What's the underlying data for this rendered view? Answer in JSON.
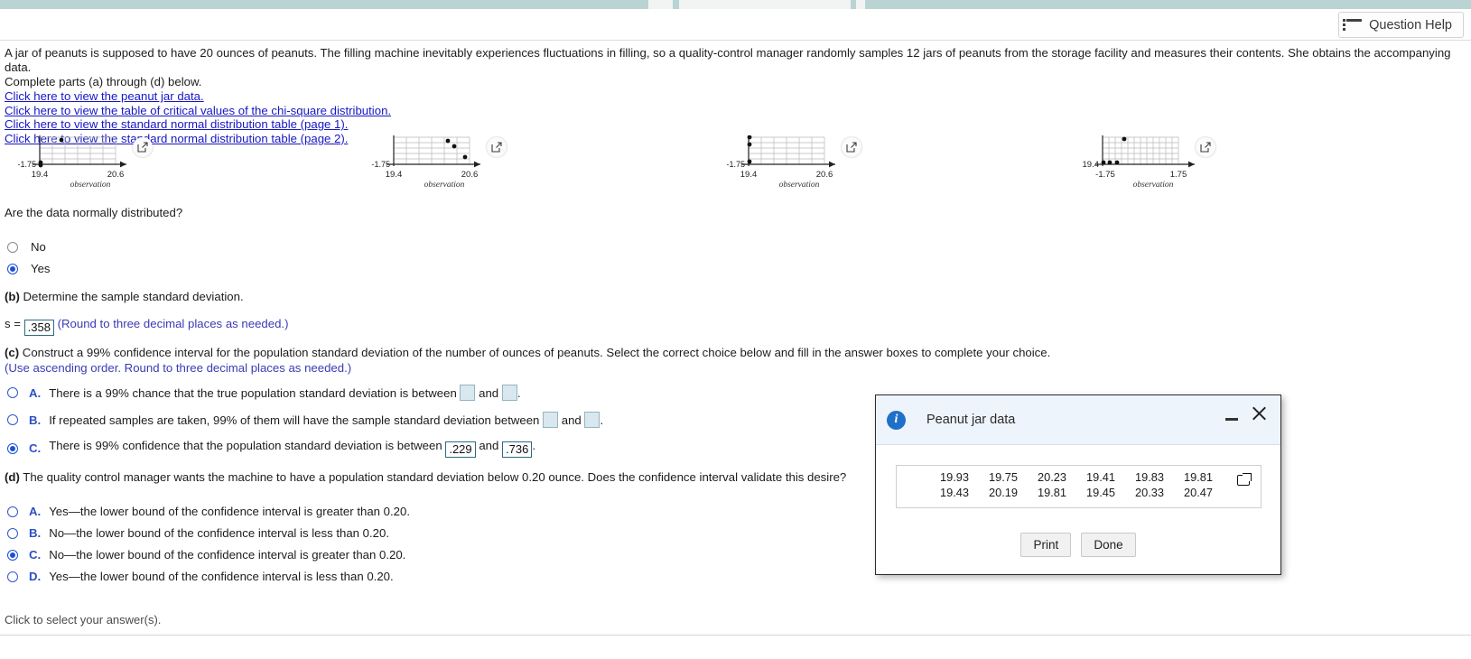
{
  "header": {
    "help_button_label": "Question Help",
    "help_icon": "list-icon"
  },
  "problem": {
    "paragraph": "A jar of peanuts is supposed to have 20 ounces of peanuts. The filling machine inevitably experiences fluctuations in filling, so a quality-control manager randomly samples 12 jars of peanuts from the storage facility and measures their contents. She obtains the accompanying data.",
    "instruction": "Complete parts (a) through (d) below.",
    "links": [
      "Click here to view the peanut jar data.",
      "Click here to view the table of critical values of the chi-square distribution.",
      "Click here to view the standard normal distribution table (page 1).",
      "Click here to view the standard normal distribution table (page 2)."
    ]
  },
  "plots": {
    "axis_caption": "observation",
    "expand_icon": "expand-icon",
    "items": [
      {
        "ylabel": "-1.75",
        "xmin_label": "19.4",
        "xmax_label": "20.6"
      },
      {
        "ylabel": "-1.75",
        "xmin_label": "19.4",
        "xmax_label": "20.6"
      },
      {
        "ylabel": "-1.75",
        "xmin_label": "19.4",
        "xmax_label": "20.6"
      },
      {
        "ylabel": "19.4",
        "xmin_label": "-1.75",
        "xmax_label": "1.75"
      }
    ]
  },
  "part_a": {
    "question": "Are the data normally distributed?",
    "options": [
      {
        "label": "No",
        "selected": false
      },
      {
        "label": "Yes",
        "selected": true
      }
    ]
  },
  "part_b": {
    "prefix": "(b)",
    "text": "Determine the sample standard deviation.",
    "s_label": "s =",
    "s_value": ".358",
    "rounding_hint": "(Round to three decimal places as needed.)"
  },
  "part_c": {
    "prefix": "(c)",
    "text": "Construct a 99% confidence interval for the population standard deviation of the number of ounces of peanuts. Select the correct choice below and fill in the answer boxes to complete your choice.",
    "hint": "(Use ascending order. Round to three decimal places as needed.)",
    "and_word": "and",
    "period": ".",
    "options": [
      {
        "letter": "A.",
        "text_before": "There is a 99% chance that the true population standard deviation is between",
        "value1": "",
        "value2": "",
        "selected": false
      },
      {
        "letter": "B.",
        "text_before": "If repeated samples are taken, 99% of them will have the sample standard deviation between",
        "value1": "",
        "value2": "",
        "selected": false
      },
      {
        "letter": "C.",
        "text_before": "There is 99% confidence that the population standard deviation is between",
        "value1": ".229",
        "value2": ".736",
        "selected": true
      }
    ]
  },
  "part_d": {
    "prefix": "(d)",
    "text": "The quality control manager wants the machine to have a population standard deviation below 0.20 ounce. Does the confidence interval validate this desire?",
    "options": [
      {
        "letter": "A.",
        "label": "Yes—the lower bound of the confidence interval is greater than 0.20.",
        "selected": false
      },
      {
        "letter": "B.",
        "label": "No—the lower bound of the confidence interval is less than 0.20.",
        "selected": false
      },
      {
        "letter": "C.",
        "label": "No—the lower bound of the confidence interval is greater than 0.20.",
        "selected": true
      },
      {
        "letter": "D.",
        "label": "Yes—the lower bound of the confidence interval is less than 0.20.",
        "selected": false
      }
    ]
  },
  "dialog": {
    "title": "Peanut jar data",
    "info_icon": "info-icon",
    "minimize_icon": "minimize-icon",
    "close_icon": "close-icon",
    "copy_icon": "copy-icon",
    "rows": [
      [
        "19.93",
        "19.75",
        "20.23",
        "19.41",
        "19.83",
        "19.81"
      ],
      [
        "19.43",
        "20.19",
        "19.81",
        "19.45",
        "20.33",
        "20.47"
      ]
    ],
    "print_label": "Print",
    "done_label": "Done"
  },
  "footer": {
    "status": "Click to select your answer(s)."
  }
}
